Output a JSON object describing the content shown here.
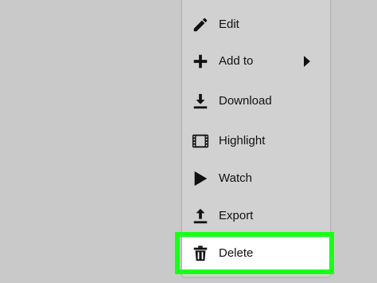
{
  "menu": {
    "items": [
      {
        "label": "Edit",
        "icon": "pencil-icon"
      },
      {
        "label": "Add to",
        "icon": "plus-icon",
        "submenu": true
      },
      {
        "label": "Download",
        "icon": "download-icon"
      },
      {
        "label": "Highlight",
        "icon": "film-icon"
      },
      {
        "label": "Watch",
        "icon": "play-icon"
      },
      {
        "label": "Export",
        "icon": "upload-icon"
      },
      {
        "label": "Delete",
        "icon": "trash-icon",
        "highlighted": true
      }
    ]
  },
  "colors": {
    "background": "#c9c9c9",
    "menu_background": "#d1d1d1",
    "highlight_outline": "#19ff19",
    "highlighted_item_background": "#ffffff",
    "text": "#111111"
  }
}
